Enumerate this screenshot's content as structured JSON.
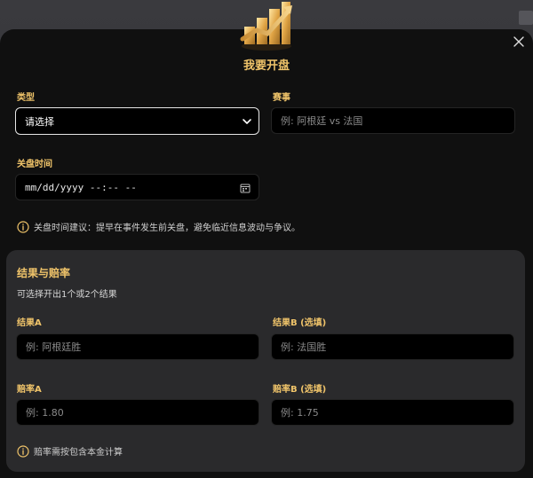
{
  "modal": {
    "title": "我要开盘",
    "close_icon": "close-icon",
    "logo_icon": "gold-bar-chart-icon"
  },
  "form": {
    "type_label": "类型",
    "type_value": "请选择",
    "match_label": "赛事",
    "match_placeholder": "例: 阿根廷 vs 法国",
    "close_time_label": "关盘时间",
    "close_time_value": "mm/dd/yyyy --:-- --",
    "close_time_hint": "关盘时间建议：提早在事件发生前关盘，避免临近信息波动与争议。"
  },
  "outcomes": {
    "title": "结果与赔率",
    "subtitle": "可选择开出1个或2个结果",
    "result_a_label": "结果A",
    "result_a_placeholder": "例: 阿根廷胜",
    "result_b_label": "结果B (选填)",
    "result_b_placeholder": "例: 法国胜",
    "odds_a_label": "赔率A",
    "odds_a_placeholder": "例: 1.80",
    "odds_b_label": "赔率B (选填)",
    "odds_b_placeholder": "例: 1.75",
    "odds_hint": "赔率需按包含本金计算"
  },
  "colors": {
    "accent": "#f0c46a",
    "background": "#101010",
    "section": "#2a2a2c"
  }
}
